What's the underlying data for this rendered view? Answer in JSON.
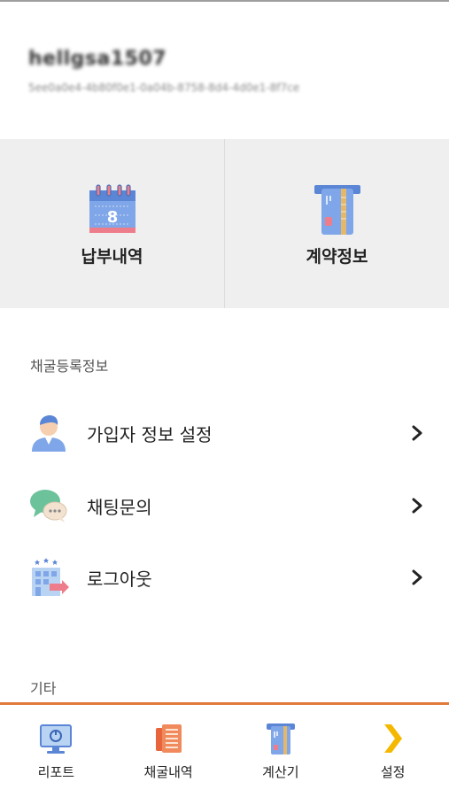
{
  "profile": {
    "username": "hellgsa1507",
    "user_id": "5ee0a0e4-4b80f0e1-0a04b-8758-8d4-4d0e1-8f7ce"
  },
  "quick_actions": [
    {
      "label": "납부내역",
      "icon": "calendar-icon"
    },
    {
      "label": "계약정보",
      "icon": "card-icon"
    }
  ],
  "section_registration": {
    "title": "채굴등록정보",
    "items": [
      {
        "label": "가입자 정보 설정",
        "icon": "user-profile-icon"
      },
      {
        "label": "채팅문의",
        "icon": "chat-bubbles-icon"
      },
      {
        "label": "로그아웃",
        "icon": "building-exit-icon"
      }
    ]
  },
  "section_other": {
    "title": "기타"
  },
  "tabbar": {
    "accent_color": "#e07a3a",
    "tabs": [
      {
        "label": "리포트",
        "icon": "monitor-icon"
      },
      {
        "label": "채굴내역",
        "icon": "ledger-icon"
      },
      {
        "label": "계산기",
        "icon": "card-icon"
      },
      {
        "label": "설정",
        "icon": "chevron-right-icon"
      }
    ]
  }
}
